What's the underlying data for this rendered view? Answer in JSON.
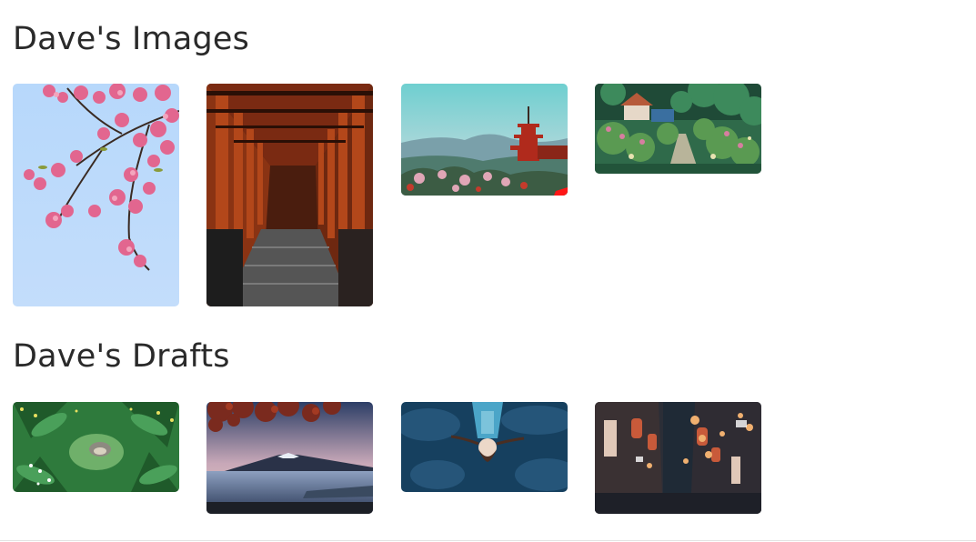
{
  "sections": [
    {
      "title": "Dave's Images",
      "items": [
        {
          "name": "cherry-blossom-image"
        },
        {
          "name": "torii-gate-path-image"
        },
        {
          "name": "pagoda-landscape-image"
        },
        {
          "name": "anime-garden-path-image"
        }
      ]
    },
    {
      "title": "Dave's Drafts",
      "items": [
        {
          "name": "forest-creature-image"
        },
        {
          "name": "mount-fuji-lake-image"
        },
        {
          "name": "anime-falling-girl-image"
        },
        {
          "name": "night-alley-lanterns-image"
        }
      ]
    }
  ]
}
